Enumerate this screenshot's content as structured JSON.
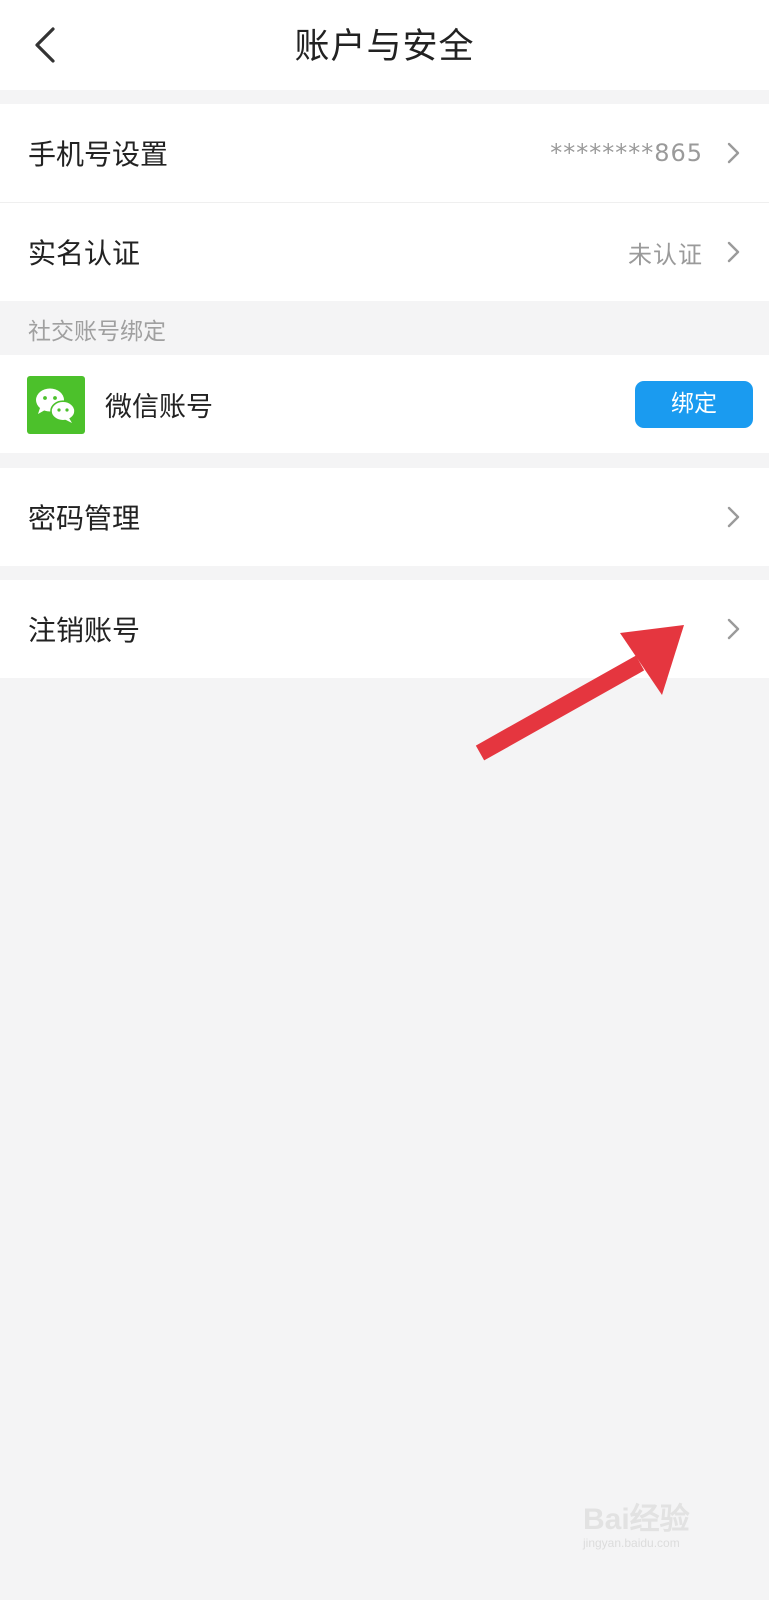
{
  "header": {
    "title": "账户与安全"
  },
  "account_group": {
    "items": [
      {
        "label": "手机号设置",
        "value": "********865"
      },
      {
        "label": "实名认证",
        "value": "未认证"
      }
    ]
  },
  "social_section": {
    "label": "社交账号绑定",
    "wechat": {
      "label": "微信账号",
      "button_label": "绑定"
    }
  },
  "password": {
    "label": "密码管理"
  },
  "deactivate": {
    "label": "注销账号"
  },
  "annotation": {
    "arrow_color": "#e5363f"
  },
  "watermark": {
    "text": "Bai经验",
    "url": "jingyan.baidu.com"
  },
  "colors": {
    "background": "#f4f4f5",
    "accent_button": "#1a9bf0",
    "wechat_green": "#4cc12b"
  }
}
